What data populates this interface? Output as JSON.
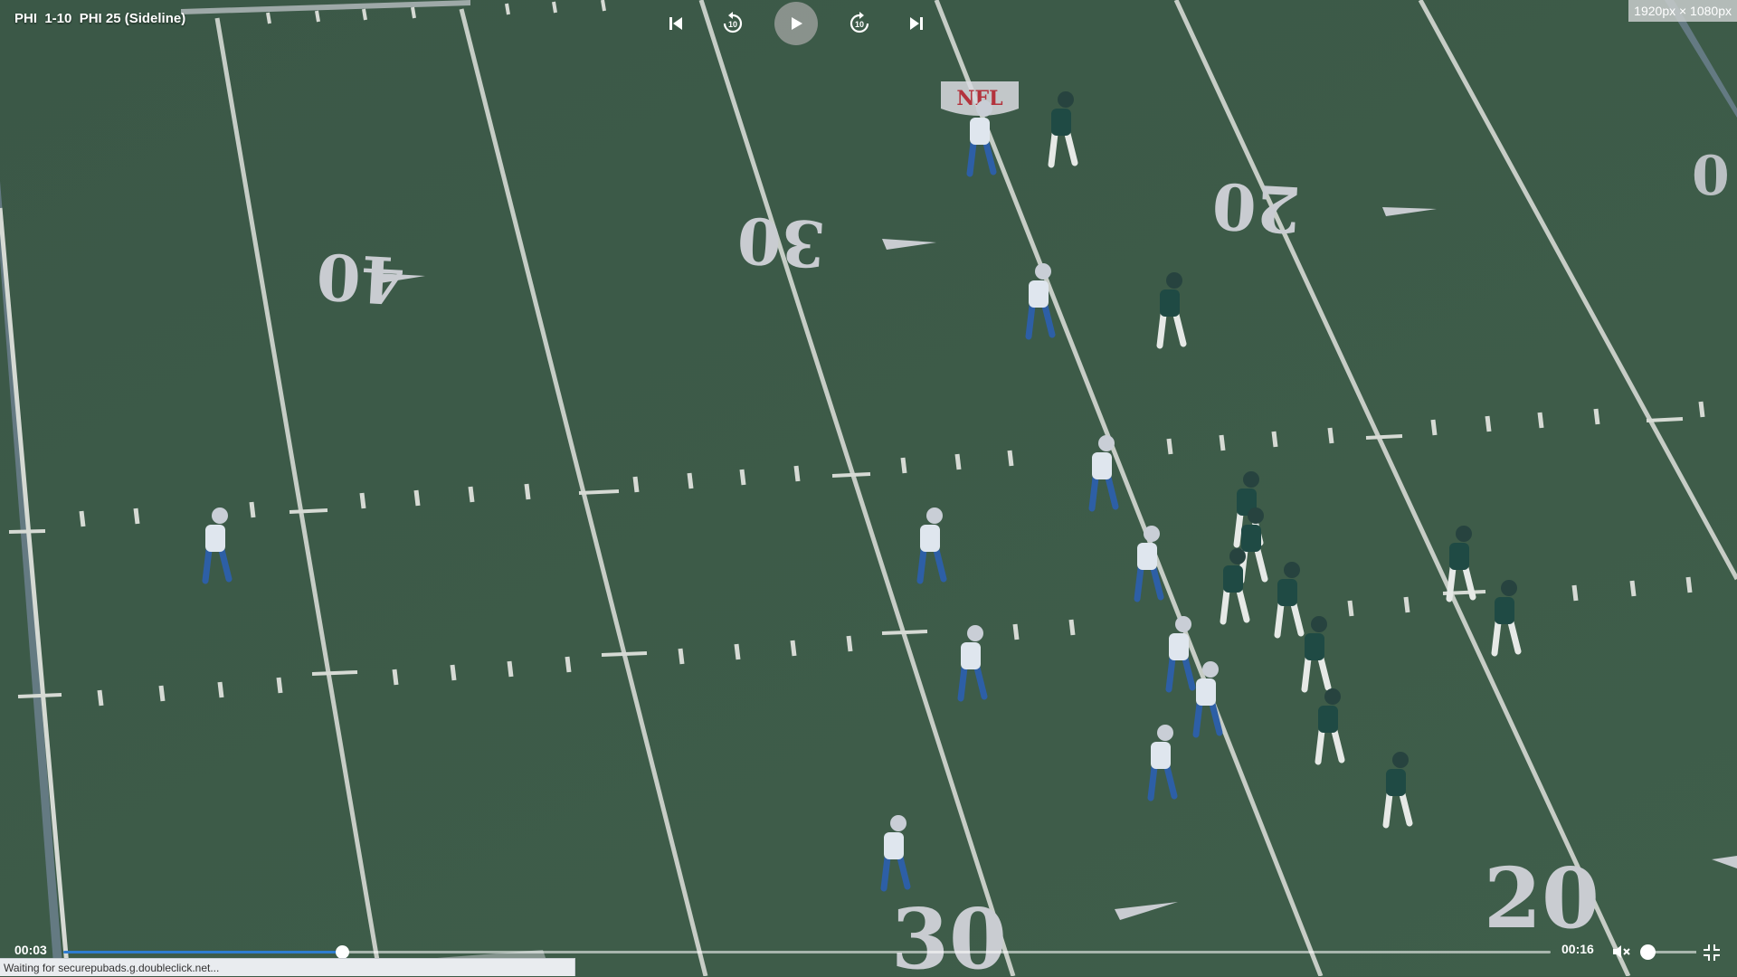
{
  "video": {
    "title": "PHI  1-10  PHI 25 (Sideline)",
    "current_time": "00:03",
    "total_time": "00:16",
    "progress_fraction": 0.1875,
    "volume_fraction": 0.1,
    "muted": true
  },
  "dimension_badge": "1920px × 1080px",
  "status_bar": "Waiting for securepubads.g.doubleclick.net...",
  "field": {
    "yard_markers": [
      "40",
      "30",
      "20",
      "30",
      "20"
    ],
    "colors": {
      "turf": "#3c5a47",
      "turf_dark": "#35503f",
      "lines": "#d8dbd6",
      "home_jersey": "#dfe6ee",
      "home_accent": "#2d5fa6",
      "away_jersey": "#1f4a44"
    },
    "logo_text": "NFL"
  },
  "controls": {
    "skip_back": "skip-to-start-icon",
    "rewind": "rewind-10-icon",
    "play": "play-icon",
    "forward": "forward-10-icon",
    "skip_forward": "skip-to-end-icon",
    "rewind_label": "10",
    "forward_label": "10"
  }
}
